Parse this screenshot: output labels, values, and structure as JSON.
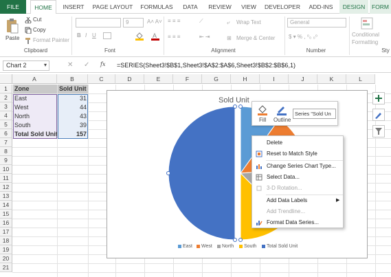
{
  "tabs": [
    "FILE",
    "HOME",
    "INSERT",
    "PAGE LAYOUT",
    "FORMULAS",
    "DATA",
    "REVIEW",
    "VIEW",
    "DEVELOPER",
    "ADD-INS",
    "DESIGN",
    "FORM"
  ],
  "ribbon": {
    "clipboard": {
      "paste": "Paste",
      "cut": "Cut",
      "copy": "Copy",
      "format_painter": "Format Painter",
      "label": "Clipboard"
    },
    "font": {
      "size": "9",
      "label": "Font"
    },
    "alignment": {
      "wrap_text": "Wrap Text",
      "merge_center": "Merge & Center",
      "label": "Alignment"
    },
    "number": {
      "format": "General",
      "label": "Number"
    },
    "styles": {
      "conditional_formatting_1": "Conditional",
      "conditional_formatting_2": "Formatting",
      "label": "Sty"
    }
  },
  "formula_bar": {
    "name_box": "Chart 2",
    "fx": "fx",
    "formula": "=SERIES(Sheet3!$B$1,Sheet3!$A$2:$A$6,Sheet3!$B$2:$B$6,1)"
  },
  "columns": [
    "A",
    "B",
    "C",
    "D",
    "E",
    "F",
    "G",
    "H",
    "I",
    "J",
    "K",
    "L"
  ],
  "rows": [
    "1",
    "2",
    "3",
    "4",
    "5",
    "6",
    "7",
    "8",
    "9",
    "10",
    "11",
    "12",
    "13",
    "14",
    "15",
    "16",
    "17",
    "18",
    "19",
    "20",
    "21"
  ],
  "table": {
    "headers": [
      "Zone",
      "Sold Unit"
    ],
    "rows": [
      [
        "East",
        "31"
      ],
      [
        "West",
        "44"
      ],
      [
        "North",
        "43"
      ],
      [
        "South",
        "39"
      ],
      [
        "Total Sold Unit",
        "157"
      ]
    ]
  },
  "chart": {
    "title": "Sold Unit",
    "legend": [
      "East",
      "West",
      "North",
      "South",
      "Total Sold Unit"
    ],
    "colors": {
      "East": "#5b9bd5",
      "West": "#ed7d31",
      "North": "#a5a5a5",
      "South": "#ffc000",
      "Total Sold Unit": "#4472c4"
    }
  },
  "chart_data": {
    "type": "pie",
    "title": "Sold Unit",
    "categories": [
      "East",
      "West",
      "North",
      "South",
      "Total Sold Unit"
    ],
    "values": [
      31,
      44,
      43,
      39,
      157
    ]
  },
  "mini_toolbar": {
    "fill": "Fill",
    "outline": "Outline",
    "series": "Series \"Sold Un"
  },
  "context_menu": [
    {
      "label": "Delete",
      "enabled": true
    },
    {
      "label": "Reset to Match Style",
      "enabled": true
    },
    {
      "label": "Change Series Chart Type...",
      "enabled": true
    },
    {
      "label": "Select Data...",
      "enabled": true
    },
    {
      "label": "3-D Rotation...",
      "enabled": false
    },
    {
      "label": "Add Data Labels",
      "enabled": true
    },
    {
      "label": "Add Trendline...",
      "enabled": false
    },
    {
      "label": "Format Data Series...",
      "enabled": true
    }
  ]
}
